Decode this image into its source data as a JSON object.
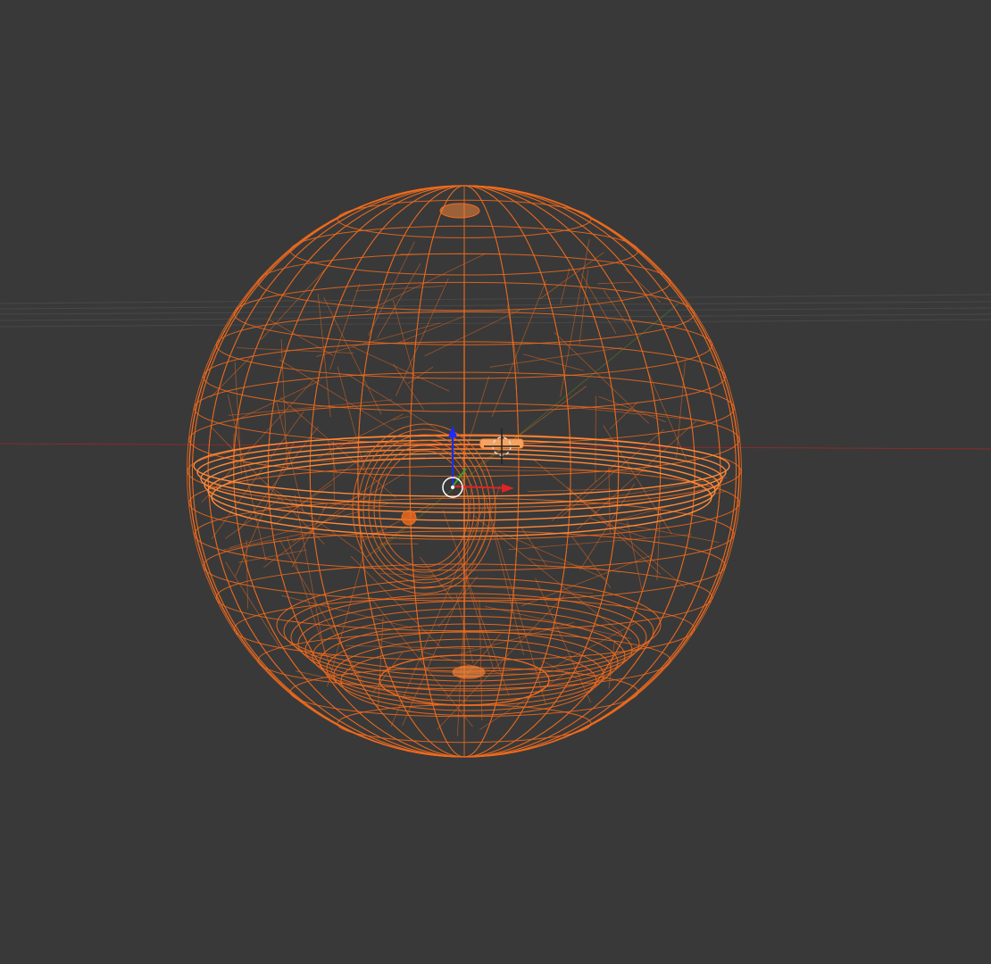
{
  "viewport": {
    "mode": "wireframe",
    "background_color": "#393939",
    "selection_color": "#f26b1d",
    "selection_color_light": "#ff8a3a",
    "grid_color": "#4a4a4a",
    "x_axis_color": "#8c2b2b",
    "y_axis_color": "#4e7d2a",
    "z_axis_color": "#2b3fd9",
    "active_object": "sphere-wireframe-object"
  },
  "gizmo": {
    "origin_icon": "object-origin-circle-icon",
    "cursor_icon": "3d-cursor-crosshair-icon",
    "axis_x_color": "#e02424",
    "axis_y_color": "#3aa02a",
    "axis_z_color": "#1e2bff"
  }
}
